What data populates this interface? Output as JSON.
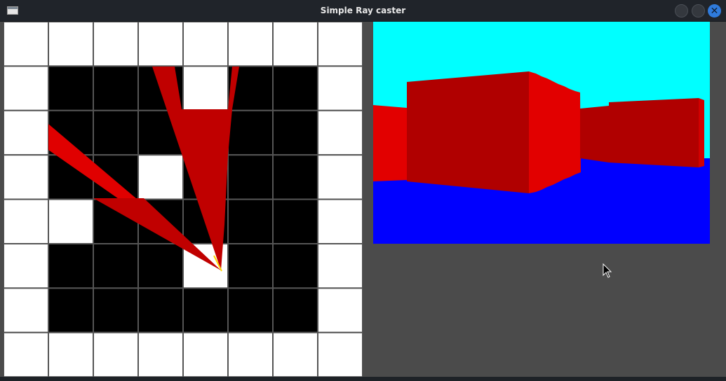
{
  "window": {
    "title": "Simple Ray caster",
    "icon": "app-window-icon",
    "buttons": [
      "minimize-icon",
      "maximize-icon",
      "close-icon"
    ],
    "close_glyph": "✕"
  },
  "map": {
    "grid": [
      [
        0,
        0,
        0,
        0,
        0,
        0,
        0,
        0
      ],
      [
        0,
        1,
        1,
        1,
        0,
        1,
        1,
        0
      ],
      [
        0,
        1,
        1,
        1,
        1,
        1,
        1,
        0
      ],
      [
        0,
        1,
        1,
        0,
        1,
        1,
        1,
        0
      ],
      [
        0,
        0,
        1,
        1,
        1,
        1,
        1,
        0
      ],
      [
        0,
        1,
        1,
        1,
        0,
        1,
        1,
        0
      ],
      [
        0,
        1,
        1,
        1,
        1,
        1,
        1,
        0
      ],
      [
        0,
        0,
        0,
        0,
        0,
        0,
        0,
        0
      ]
    ],
    "colors": {
      "wall": "#ffffff",
      "floor": "#000000",
      "grid_line": "#555555",
      "ray": "#c80000",
      "ray_bright": "#e60000",
      "player": "#ffd400"
    }
  },
  "view": {
    "colors": {
      "sky": "#00ffff",
      "ground": "#0000ff",
      "wall_front": "#b00000",
      "wall_side": "#e20000"
    }
  }
}
